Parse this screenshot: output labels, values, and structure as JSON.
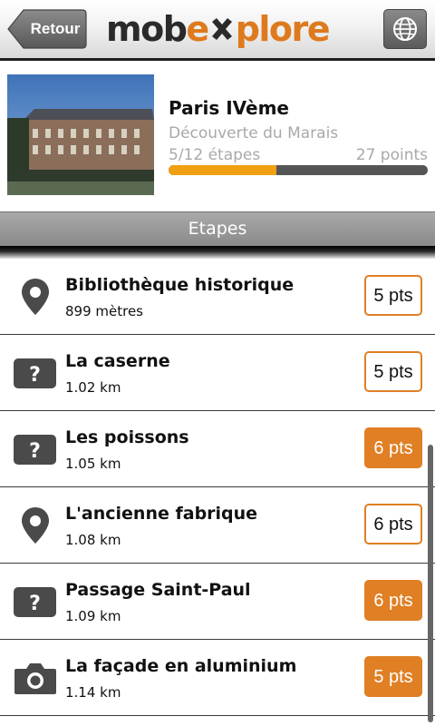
{
  "header": {
    "back_label": "Retour",
    "logo": {
      "part1": "mob",
      "part2": "e",
      "part3": "plore",
      "icon": "x-mark-icon"
    },
    "globe_icon": "globe-icon"
  },
  "tour": {
    "title": "Paris IVème",
    "subtitle": "Découverte du Marais",
    "steps_text": "5/12 étapes",
    "points_text": "27 points",
    "progress_fraction": 0.4167
  },
  "section": {
    "title": "Etapes"
  },
  "colors": {
    "accent": "#e07f24",
    "progress": "#f0a010"
  },
  "steps": [
    {
      "name": "Bibliothèque historique",
      "distance": "899 mètres",
      "points": "5 pts",
      "icon": "map-pin-icon",
      "filled": false
    },
    {
      "name": "La caserne",
      "distance": "1.02 km",
      "points": "5 pts",
      "icon": "question-icon",
      "filled": false
    },
    {
      "name": "Les poissons",
      "distance": "1.05 km",
      "points": "6 pts",
      "icon": "question-icon",
      "filled": true
    },
    {
      "name": "L'ancienne fabrique",
      "distance": "1.08 km",
      "points": "6 pts",
      "icon": "map-pin-icon",
      "filled": false
    },
    {
      "name": "Passage Saint-Paul",
      "distance": "1.09 km",
      "points": "6 pts",
      "icon": "question-icon",
      "filled": true
    },
    {
      "name": "La façade en aluminium",
      "distance": "1.14 km",
      "points": "5 pts",
      "icon": "camera-icon",
      "filled": true
    }
  ]
}
